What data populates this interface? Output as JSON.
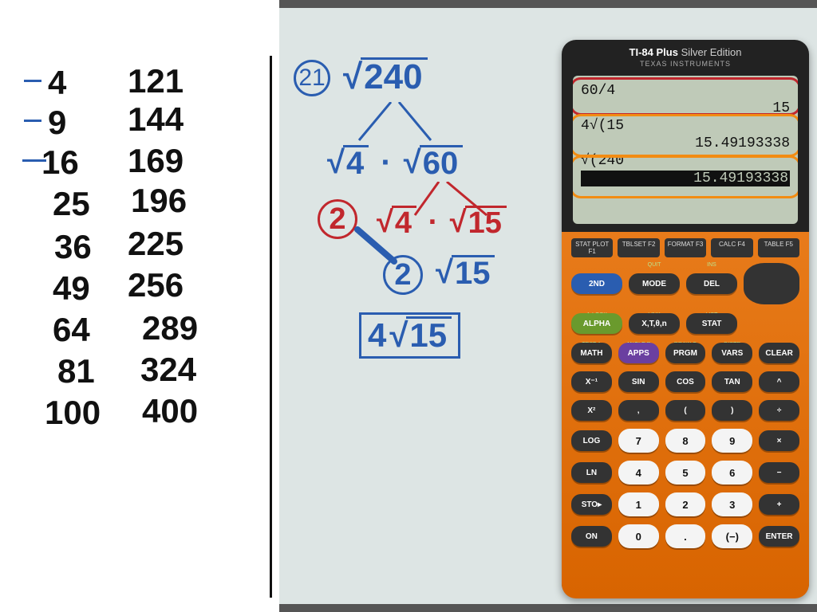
{
  "perfect_squares": {
    "col1": [
      "4",
      "9",
      "16",
      "25",
      "36",
      "49",
      "64",
      "81",
      "100"
    ],
    "col2": [
      "121",
      "144",
      "169",
      "196",
      "225",
      "256",
      "289",
      "324",
      "400"
    ]
  },
  "problem": {
    "number": "21",
    "root_of": "240",
    "step1_a": "4",
    "step1_b": "60",
    "factor1": "2",
    "step2_a": "4",
    "step2_b": "15",
    "factor2": "2",
    "remain": "15",
    "answer_coeff": "4",
    "answer_rad": "15"
  },
  "calculator": {
    "title_brand": "TI-84 Plus",
    "title_edition": "Silver Edition",
    "subtitle": "TEXAS INSTRUMENTS",
    "screen": {
      "l1_left": "60/4",
      "l1_right": "15",
      "l2_left": "4√(15",
      "l2_right": "15.49193338",
      "l3_left": "√(240",
      "l3_right": "15.49193338"
    },
    "fkeys": [
      "STAT PLOT F1",
      "TBLSET F2",
      "FORMAT F3",
      "CALC F4",
      "TABLE F5"
    ],
    "row1": [
      "2ND",
      "MODE",
      "DEL"
    ],
    "row1_labels": [
      "",
      "QUIT",
      "INS"
    ],
    "row2": [
      "ALPHA",
      "X,T,θ,n",
      "STAT"
    ],
    "row2_labels": [
      "A-LOCK",
      "LINK",
      "LIST"
    ],
    "row3": [
      "MATH",
      "APPS",
      "PRGM",
      "VARS",
      "CLEAR"
    ],
    "row3_labels": [
      "TEST A",
      "ANGLE B",
      "DRAW C",
      "DISTR",
      ""
    ],
    "row4": [
      "X⁻¹",
      "SIN",
      "COS",
      "TAN",
      "^"
    ],
    "row5": [
      "X²",
      ",",
      "(",
      ")",
      "÷"
    ],
    "row6": [
      "LOG",
      "7",
      "8",
      "9",
      "×"
    ],
    "row7": [
      "LN",
      "4",
      "5",
      "6",
      "−"
    ],
    "row8": [
      "STO▸",
      "1",
      "2",
      "3",
      "+"
    ],
    "row9": [
      "ON",
      "0",
      ".",
      "(−)",
      "ENTER"
    ]
  }
}
